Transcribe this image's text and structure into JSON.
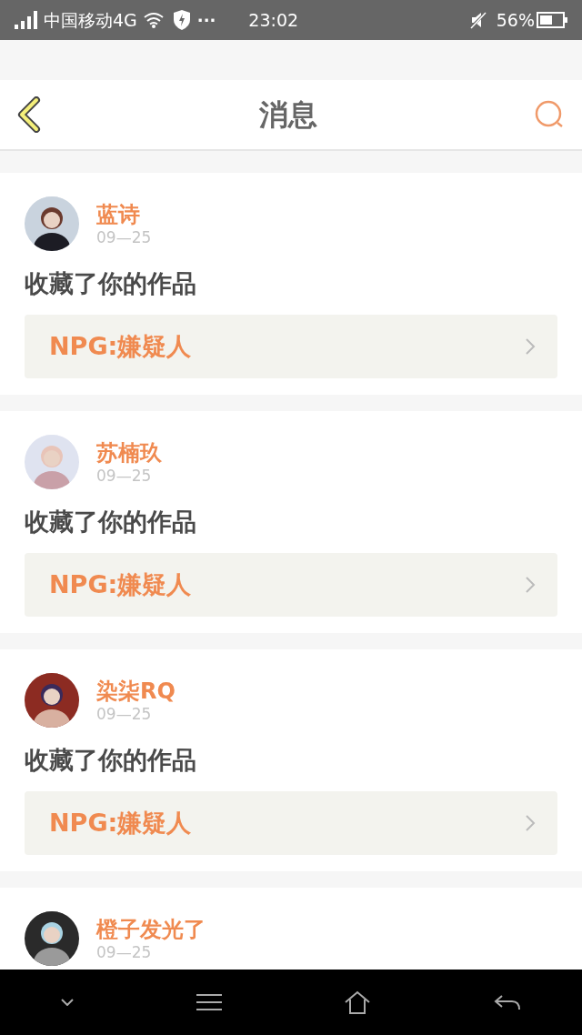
{
  "status_bar": {
    "carrier": "中国移动4G",
    "dots": "···",
    "time": "23:02",
    "battery": "56%"
  },
  "header": {
    "title": "消息"
  },
  "messages": [
    {
      "name": "蓝诗",
      "date": "09—25",
      "action": "收藏了你的作品",
      "work": "NPG:嫌疑人"
    },
    {
      "name": "苏楠玖",
      "date": "09—25",
      "action": "收藏了你的作品",
      "work": "NPG:嫌疑人"
    },
    {
      "name": "染柒RQ",
      "date": "09—25",
      "action": "收藏了你的作品",
      "work": "NPG:嫌疑人"
    },
    {
      "name": "橙子发光了",
      "date": "09—25"
    }
  ]
}
